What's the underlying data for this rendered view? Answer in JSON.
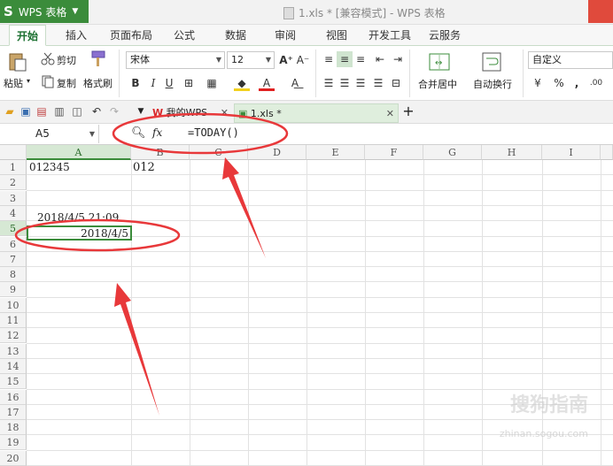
{
  "app": {
    "logo": "S",
    "name": "WPS 表格",
    "window_title": "1.xls * [兼容模式] - WPS 表格"
  },
  "menu_tabs": [
    "开始",
    "插入",
    "页面布局",
    "公式",
    "数据",
    "审阅",
    "视图",
    "开发工具",
    "云服务"
  ],
  "ribbon": {
    "paste": "粘贴",
    "cut": "剪切",
    "copy": "复制",
    "format_painter": "格式刷",
    "font_name": "宋体",
    "font_size": "12",
    "merge_center": "合并居中",
    "wrap_text": "自动换行",
    "number_format": "自定义",
    "percent": "%",
    "comma": ","
  },
  "doc_tabs": [
    {
      "label": "我的WPS"
    },
    {
      "label": "1.xls *"
    }
  ],
  "formula_bar": {
    "name_box": "A5",
    "fx": "fx",
    "formula": "=TODAY()"
  },
  "columns": [
    "A",
    "B",
    "C",
    "D",
    "E",
    "F",
    "G",
    "H",
    "I"
  ],
  "rows": [
    "1",
    "2",
    "3",
    "4",
    "5",
    "6",
    "7",
    "8",
    "9",
    "10",
    "11",
    "12",
    "13",
    "14",
    "15",
    "16",
    "17",
    "18",
    "19",
    "20"
  ],
  "cells": {
    "A1": "012345",
    "B1": "012",
    "A4": "2018/4/5  21:09",
    "A5": "2018/4/5"
  },
  "watermark": {
    "main": "搜狗指南",
    "sub": "zhinan.sogou.com"
  },
  "colors": {
    "accent": "#3b8c3b",
    "annotation": "#e8383a"
  }
}
